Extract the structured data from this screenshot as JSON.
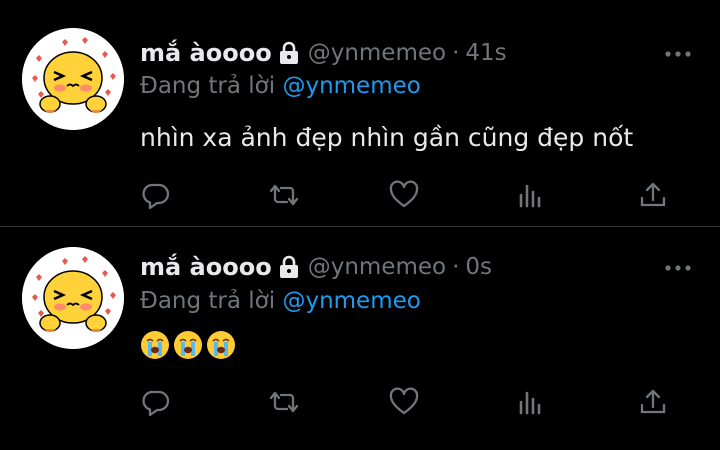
{
  "tweets": [
    {
      "display_name": "mắ àoooo",
      "handle": "@ynmemeo",
      "separator": "·",
      "time": "41s",
      "reply_prefix": "Đang trả lời",
      "reply_to": "@ynmemeo",
      "text": "nhìn xa ảnh đẹp nhìn gần cũng đẹp nốt",
      "icons": [
        "lock-icon",
        "more-icon",
        "reply-icon",
        "retweet-icon",
        "like-icon",
        "views-icon",
        "share-icon"
      ]
    },
    {
      "display_name": "mắ àoooo",
      "handle": "@ynmemeo",
      "separator": "·",
      "time": "0s",
      "reply_prefix": "Đang trả lời",
      "reply_to": "@ynmemeo",
      "emojis": [
        "crying-face",
        "crying-face",
        "crying-face"
      ],
      "icons": [
        "lock-icon",
        "more-icon",
        "reply-icon",
        "retweet-icon",
        "like-icon",
        "views-icon",
        "share-icon"
      ]
    }
  ],
  "colors": {
    "background": "#000000",
    "text": "#e7e9ea",
    "secondary": "#71767b",
    "accent": "#1d9bf0",
    "divider": "#2f3336"
  }
}
